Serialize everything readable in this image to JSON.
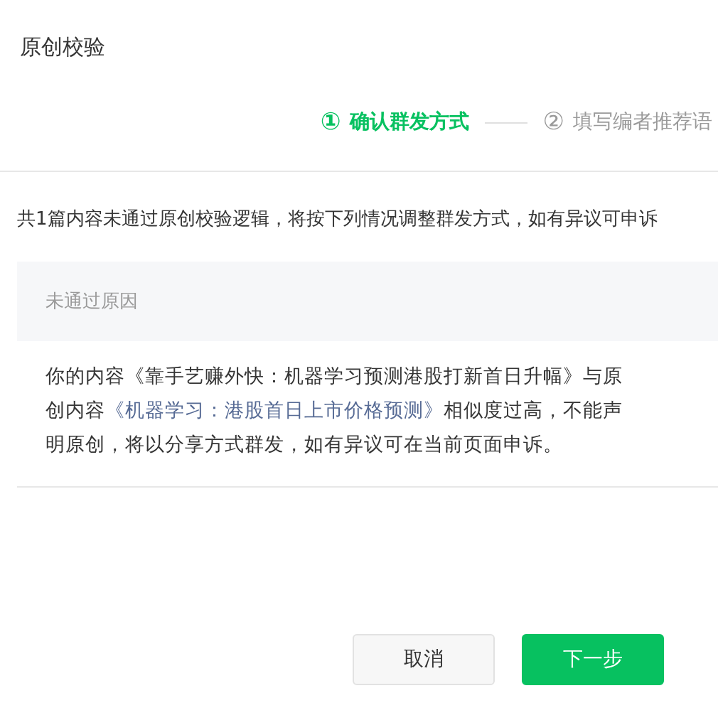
{
  "dialog": {
    "title": "原创校验"
  },
  "steps": [
    {
      "number": "①",
      "label": "确认群发方式",
      "selected": true
    },
    {
      "number": "②",
      "label": "填写编者推荐语",
      "selected": false
    }
  ],
  "notice": "共1篇内容未通过原创校验逻辑，将按下列情况调整群发方式，如有异议可申诉",
  "reason_header": "未通过原因",
  "reason": [
    {
      "kind": "text",
      "text": "你的内容《靠手艺赚外快：机器学习预测港股打新首日升幅》与原创内容"
    },
    {
      "kind": "link",
      "text": "《机器学习：港股首日上市价格预测》"
    },
    {
      "kind": "text",
      "text": "相似度过高，不能声明原创，将以分享方式群发，如有异议可在当前页面申诉。"
    }
  ],
  "buttons": [
    {
      "label": "取消",
      "kind": "secondary"
    },
    {
      "label": "下一步",
      "kind": "primary"
    }
  ]
}
